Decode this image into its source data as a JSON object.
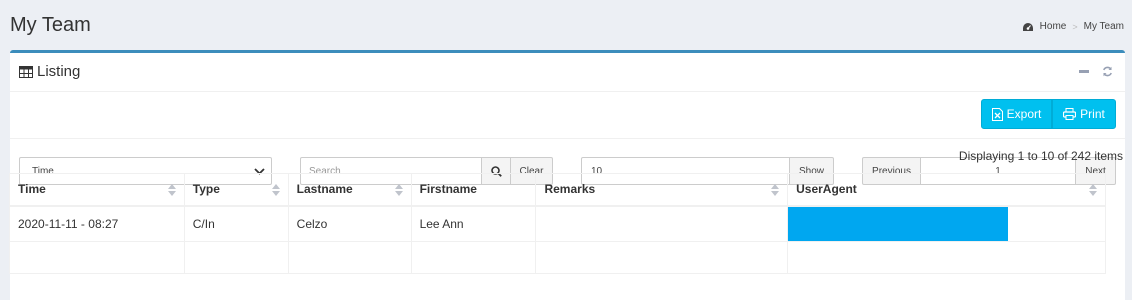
{
  "page": {
    "title": "My Team",
    "breadcrumb": {
      "home": "Home",
      "current": "My Team"
    }
  },
  "box": {
    "title": "Listing",
    "export_label": "Export",
    "print_label": "Print"
  },
  "controls": {
    "sort_select_value": "Time",
    "search_placeholder": "Search",
    "clear_label": "Clear",
    "per_page_value": "10",
    "show_label": "Show",
    "previous_label": "Previous",
    "page_value": "1",
    "next_label": "Next"
  },
  "displaying": "Displaying 1 to 10 of 242 items",
  "table": {
    "columns": [
      "Time",
      "Type",
      "Lastname",
      "Firstname",
      "Remarks",
      "UserAgent"
    ],
    "rows": [
      {
        "time": "2020-11-11 - 08:27",
        "type": "C/In",
        "lastname": "Celzo",
        "firstname": "Lee Ann",
        "remarks": "",
        "useragent": ""
      }
    ]
  },
  "colors": {
    "accent": "#3c8dbc",
    "info_button": "#00c0ef",
    "redaction": "#00a7f0"
  }
}
